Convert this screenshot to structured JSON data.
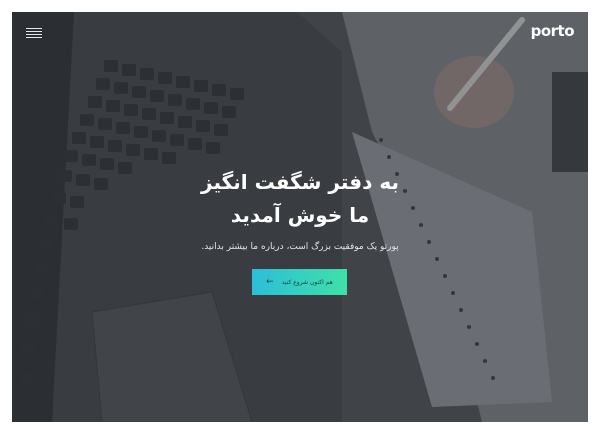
{
  "header": {
    "logo_text": "porto",
    "menu_icon": "hamburger-menu-icon"
  },
  "hero": {
    "title_line1": "به دفتر شگفت انگیز",
    "title_line2": "ما خوش آمدید",
    "subtitle": "پورتو یک موفقیت بزرگ است، درباره ما بیشتر بدانید.",
    "cta_label": "هم اکنون شروع کنید",
    "cta_icon": "arrow-left-icon"
  },
  "colors": {
    "cta_gradient_start": "#2bbfd9",
    "cta_gradient_end": "#3fe0a8"
  }
}
